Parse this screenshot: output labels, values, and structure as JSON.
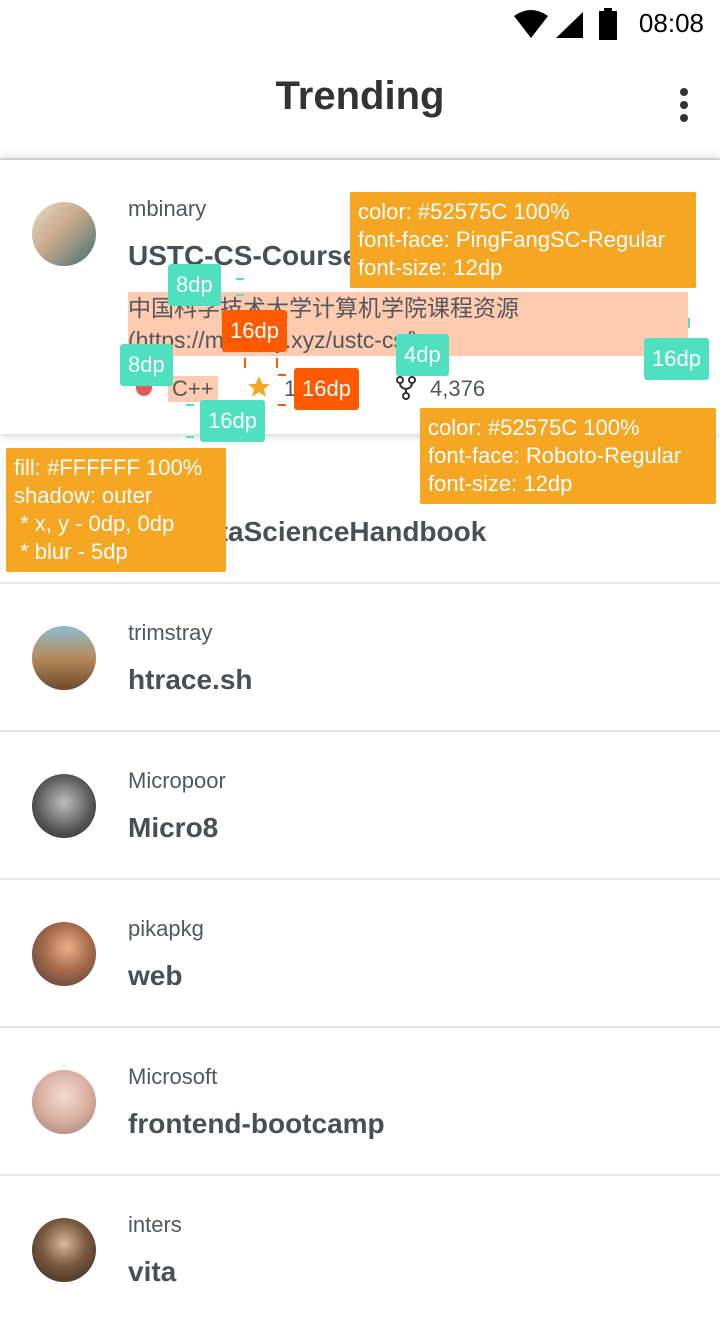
{
  "status": {
    "time": "08:08"
  },
  "appbar": {
    "title": "Trending",
    "menu_icon": "more-vert-icon"
  },
  "featured": {
    "owner": "mbinary",
    "repo": "USTC-CS-Courses-Resource",
    "description": "中国科学技术大学计算机学院课程资源(https://mbinary.xyz/ustc-cs/)",
    "language": "C++",
    "language_color": "#e05a5a",
    "stars": "16",
    "forks": "4,376"
  },
  "hidden_row": {
    "repo": "PythonDataScienceHandbook"
  },
  "repos": [
    {
      "owner": "trimstray",
      "repo": "htrace.sh"
    },
    {
      "owner": "Micropoor",
      "repo": "Micro8"
    },
    {
      "owner": "pikapkg",
      "repo": "web"
    },
    {
      "owner": "Microsoft",
      "repo": "frontend-bootcamp"
    },
    {
      "owner": "inters",
      "repo": "vita"
    }
  ],
  "annotations": {
    "title_spec": "color: #52575C 100%\nfont-face: PingFangSC-Regular\nfont-size: 12dp",
    "meta_spec": "color: #52575C 100%\nfont-face: Roboto-Regular\nfont-size: 12dp",
    "card_spec": "fill: #FFFFFF 100%\nshadow: outer\n * x, y - 0dp, 0dp\n * blur - 5dp",
    "m1": "8dp",
    "m2": "16dp",
    "m3": "8dp",
    "m4": "4dp",
    "m5": "16dp",
    "m6": "16dp",
    "m7": "16dp"
  },
  "colors": {
    "accent": "#F5A623",
    "measure": "#4FE0C0",
    "measure_alt": "#FF5A00",
    "highlight": "#FFCBB0"
  }
}
